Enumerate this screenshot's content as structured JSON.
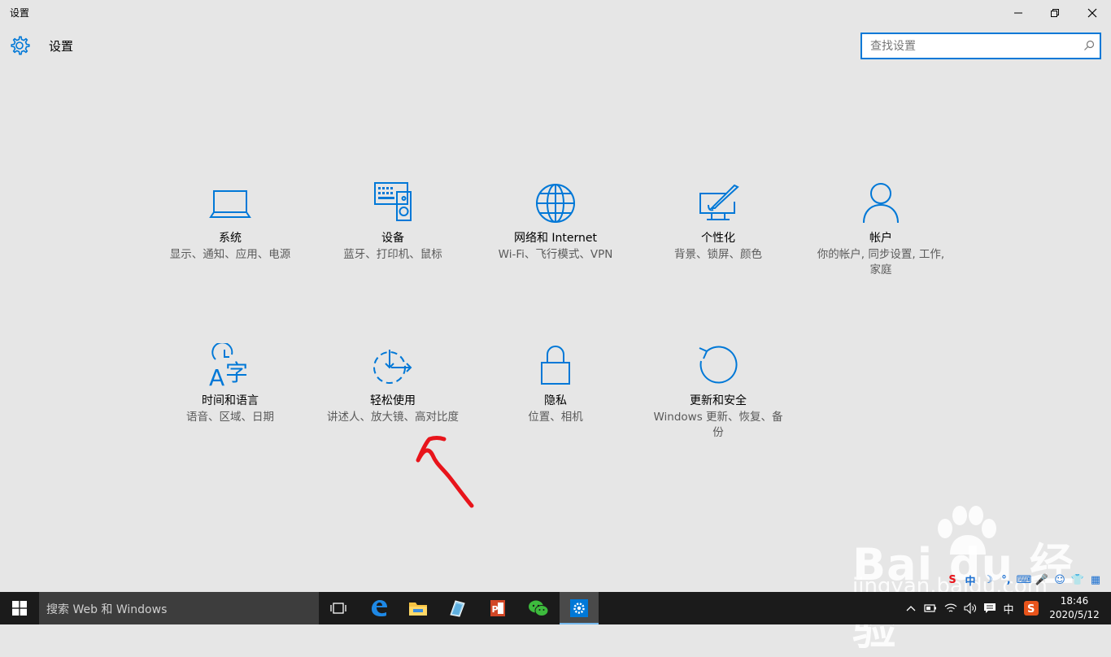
{
  "window": {
    "title": "设置",
    "controls": {
      "minimize": "–",
      "maximize": "❐",
      "close": "✕"
    }
  },
  "header": {
    "app_title": "设置",
    "search_placeholder": "查找设置"
  },
  "tiles": [
    {
      "name": "系统",
      "desc": "显示、通知、应用、电源",
      "icon": "laptop-icon"
    },
    {
      "name": "设备",
      "desc": "蓝牙、打印机、鼠标",
      "icon": "devices-icon"
    },
    {
      "name": "网络和 Internet",
      "desc": "Wi-Fi、飞行模式、VPN",
      "icon": "globe-icon"
    },
    {
      "name": "个性化",
      "desc": "背景、锁屏、颜色",
      "icon": "personalization-icon"
    },
    {
      "name": "帐户",
      "desc": "你的帐户, 同步设置, 工作, 家庭",
      "icon": "person-icon"
    },
    {
      "name": "时间和语言",
      "desc": "语音、区域、日期",
      "icon": "time-language-icon"
    },
    {
      "name": "轻松使用",
      "desc": "讲述人、放大镜、高对比度",
      "icon": "ease-of-access-icon"
    },
    {
      "name": "隐私",
      "desc": "位置、相机",
      "icon": "lock-icon"
    },
    {
      "name": "更新和安全",
      "desc": "Windows 更新、恢复、备份",
      "icon": "update-icon"
    }
  ],
  "taskbar": {
    "search_text": "搜索 Web 和 Windows",
    "ime_mode": "中",
    "time": "18:46",
    "date": "2020/5/12"
  },
  "ime_toolbar": {
    "mode": "中"
  },
  "colors": {
    "accent": "#0078d7",
    "background": "#e6e6e6",
    "taskbar": "#1b1b1b"
  }
}
